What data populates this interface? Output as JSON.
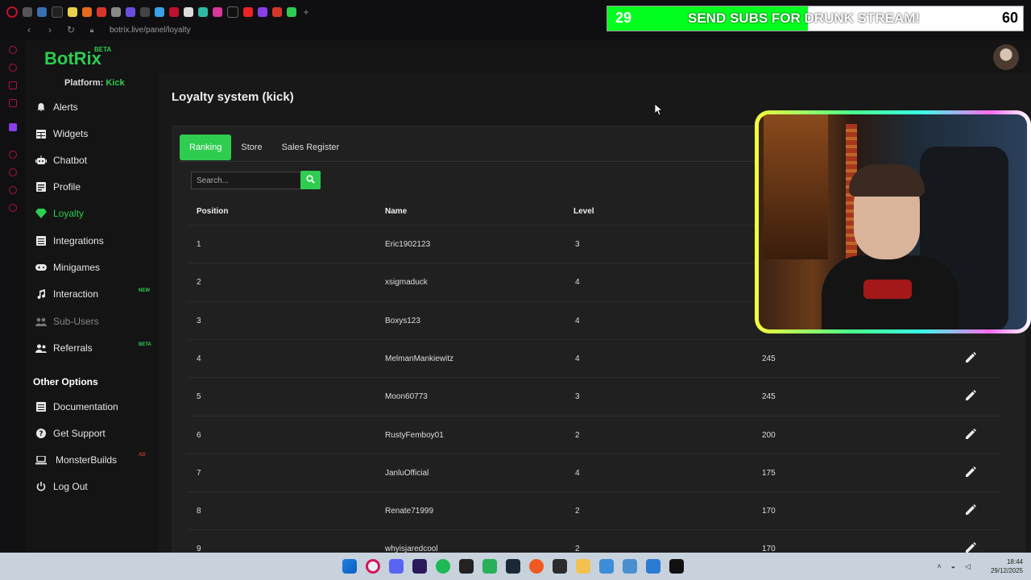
{
  "browser": {
    "url": "botrix.live/panel/loyalty"
  },
  "banner": {
    "current": "29",
    "message": "SEND SUBS FOR DRUNK STREAM!",
    "goal": "60",
    "progress_fraction": 0.483,
    "fill_color": "#00ff1e"
  },
  "app": {
    "logo": "BotRix",
    "logo_badge": "BETA",
    "platform_label": "Platform:",
    "platform_value": "Kick",
    "accent": "#2ecc4f"
  },
  "sidebar": {
    "items": [
      {
        "label": "Alerts",
        "icon": "bell-icon"
      },
      {
        "label": "Widgets",
        "icon": "grid-icon"
      },
      {
        "label": "Chatbot",
        "icon": "robot-icon"
      },
      {
        "label": "Profile",
        "icon": "id-card-icon"
      },
      {
        "label": "Loyalty",
        "icon": "gem-icon"
      },
      {
        "label": "Integrations",
        "icon": "list-icon"
      },
      {
        "label": "Minigames",
        "icon": "gamepad-icon"
      },
      {
        "label": "Interaction",
        "icon": "music-icon",
        "badge": "NEW"
      },
      {
        "label": "Sub-Users",
        "icon": "users-icon"
      },
      {
        "label": "Referrals",
        "icon": "people-icon",
        "badge": "BETA"
      }
    ],
    "other_title": "Other Options",
    "other_items": [
      {
        "label": "Documentation",
        "icon": "book-icon"
      },
      {
        "label": "Get Support",
        "icon": "question-icon"
      },
      {
        "label": "MonsterBuilds",
        "icon": "laptop-icon",
        "badge": "AD"
      },
      {
        "label": "Log Out",
        "icon": "power-icon"
      }
    ]
  },
  "main": {
    "title": "Loyalty system (kick)",
    "tabs": [
      "Ranking",
      "Store",
      "Sales Register"
    ],
    "search_placeholder": "Search...",
    "columns": [
      "Position",
      "Name",
      "Level"
    ],
    "rows": [
      {
        "position": "1",
        "name": "Eric1902123",
        "level": "3",
        "points": ""
      },
      {
        "position": "2",
        "name": "xsigmaduck",
        "level": "4",
        "points": ""
      },
      {
        "position": "3",
        "name": "Boxys123",
        "level": "4",
        "points": ""
      },
      {
        "position": "4",
        "name": "MelmanMankiewitz",
        "level": "4",
        "points": "245"
      },
      {
        "position": "5",
        "name": "Moon60773",
        "level": "3",
        "points": "245"
      },
      {
        "position": "6",
        "name": "RustyFemboy01",
        "level": "2",
        "points": "200"
      },
      {
        "position": "7",
        "name": "JanluOfficial",
        "level": "4",
        "points": "175"
      },
      {
        "position": "8",
        "name": "Renate71999",
        "level": "2",
        "points": "170"
      },
      {
        "position": "9",
        "name": "whyisjaredcool",
        "level": "2",
        "points": "170"
      }
    ]
  },
  "taskbar": {
    "time": "18:44",
    "date": "29/12/2025"
  }
}
